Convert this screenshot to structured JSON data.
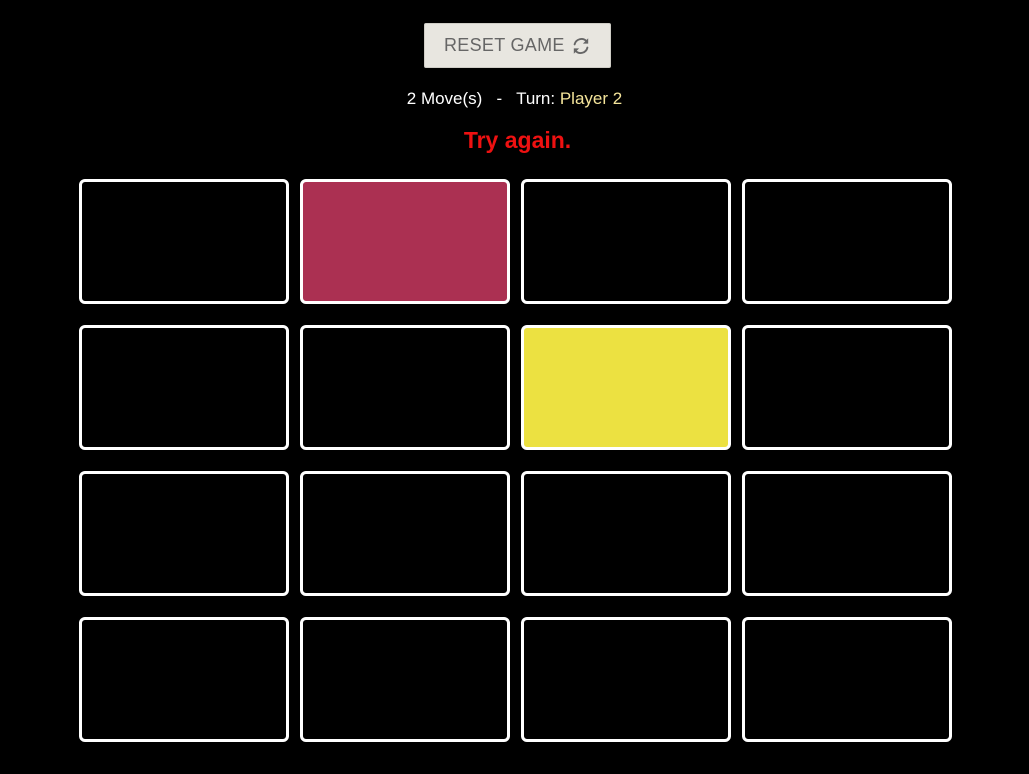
{
  "reset_button": {
    "label": "RESET GAME",
    "icon": "refresh-icon"
  },
  "status": {
    "moves": "2 Move(s)",
    "separator": "-",
    "turn_label": "Turn:",
    "player": "Player 2",
    "player_color": "#f4e49a"
  },
  "message": {
    "text": "Try again.",
    "color": "#ee1111"
  },
  "board": {
    "rows": 4,
    "cols": 4,
    "cards": [
      {
        "state": "hidden",
        "color": "#000000"
      },
      {
        "state": "revealed",
        "color": "#ab3052"
      },
      {
        "state": "hidden",
        "color": "#000000"
      },
      {
        "state": "hidden",
        "color": "#000000"
      },
      {
        "state": "hidden",
        "color": "#000000"
      },
      {
        "state": "hidden",
        "color": "#000000"
      },
      {
        "state": "revealed",
        "color": "#ece141"
      },
      {
        "state": "hidden",
        "color": "#000000"
      },
      {
        "state": "hidden",
        "color": "#000000"
      },
      {
        "state": "hidden",
        "color": "#000000"
      },
      {
        "state": "hidden",
        "color": "#000000"
      },
      {
        "state": "hidden",
        "color": "#000000"
      },
      {
        "state": "hidden",
        "color": "#000000"
      },
      {
        "state": "hidden",
        "color": "#000000"
      },
      {
        "state": "hidden",
        "color": "#000000"
      },
      {
        "state": "hidden",
        "color": "#000000"
      }
    ]
  }
}
